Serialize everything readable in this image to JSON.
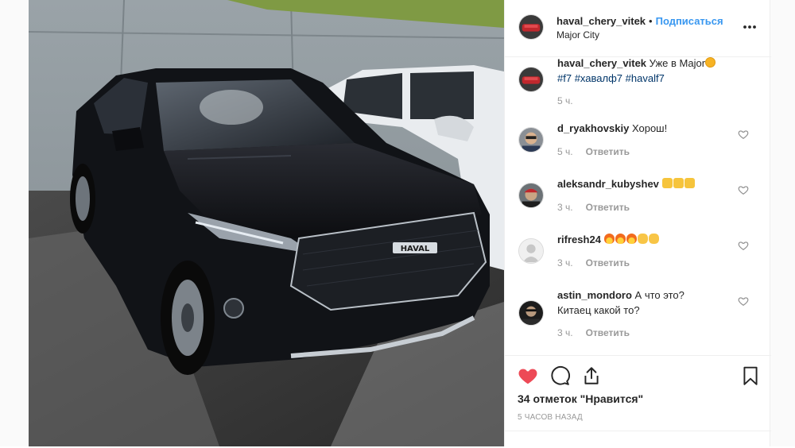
{
  "post": {
    "username": "haval_chery_vitek",
    "separator": "•",
    "follow_label": "Подписаться",
    "location": "Major City",
    "more_icon": "more-options-icon"
  },
  "caption": {
    "username": "haval_chery_vitek",
    "text": "Уже в Major",
    "emoji": "star-eyes-emoji",
    "hashtags": [
      "#f7",
      "#хавалф7",
      "#havalf7"
    ],
    "time": "5 ч."
  },
  "comments": [
    {
      "username": "d_ryakhovskiy",
      "text": "Хорош!",
      "time": "5 ч.",
      "reply": "Ответить"
    },
    {
      "username": "aleksandr_kubyshev",
      "text": "",
      "emojis": [
        "thumbs-up",
        "thumbs-up",
        "thumbs-up"
      ],
      "time": "3 ч.",
      "reply": "Ответить"
    },
    {
      "username": "rifresh24",
      "text": "",
      "emojis": [
        "fire",
        "fire",
        "fire",
        "clap",
        "clap"
      ],
      "time": "3 ч.",
      "reply": "Ответить"
    },
    {
      "username": "astin_mondoro",
      "text": "А что это?",
      "text2": "Китаец какой то?",
      "time": "3 ч.",
      "reply": "Ответить"
    }
  ],
  "actions": {
    "like_icon": "heart-filled-icon",
    "comment_icon": "comment-icon",
    "share_icon": "share-icon",
    "save_icon": "bookmark-icon",
    "likes_text": "34 отметок \"Нравится\"",
    "time_ago": "5 ЧАСОВ НАЗАД"
  },
  "colors": {
    "link": "#3897f0",
    "hashtag": "#003569",
    "like": "#ed4956",
    "muted": "#999999"
  },
  "photo": {
    "badge_text": "HAVAL"
  }
}
